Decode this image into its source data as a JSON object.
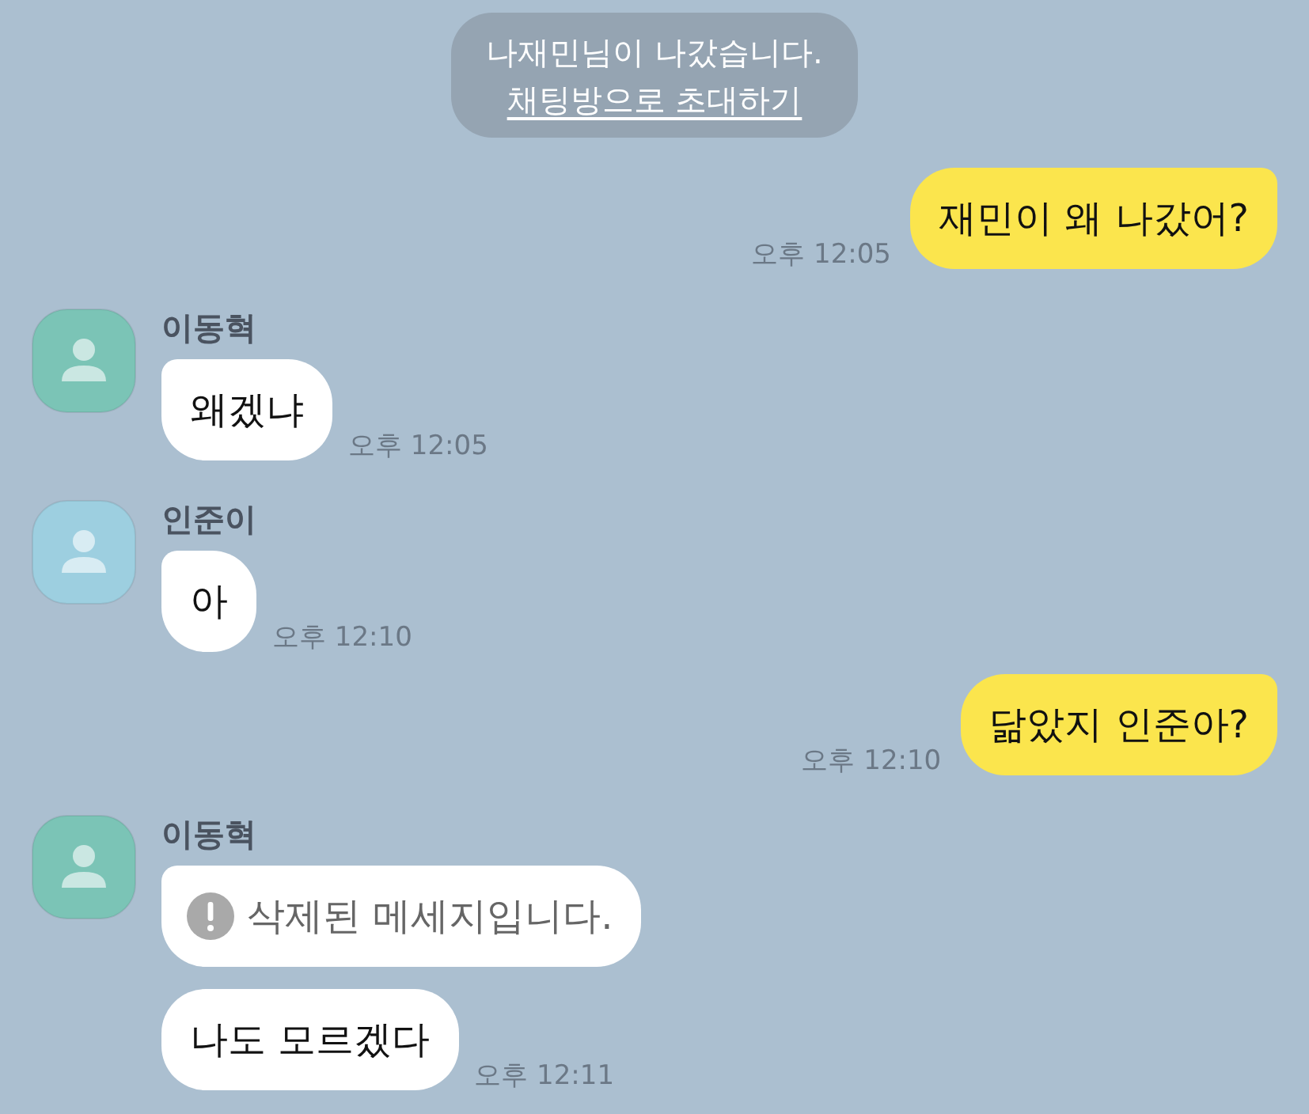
{
  "notice": {
    "text": "나재민님이 나갔습니다.",
    "link": "채팅방으로 초대하기"
  },
  "messages": [
    {
      "kind": "sent",
      "text": "재민이 왜 나갔어?",
      "time": "오후 12:05"
    },
    {
      "kind": "received",
      "sender": "이동혁",
      "color": "#7bc4b6",
      "bubbles": [
        {
          "kind": "text",
          "text": "왜겠냐"
        }
      ],
      "time": "오후 12:05"
    },
    {
      "kind": "received",
      "sender": "인준이",
      "color": "#9dcfe0",
      "bubbles": [
        {
          "kind": "text",
          "text": "아"
        }
      ],
      "time": "오후 12:10"
    },
    {
      "kind": "sent",
      "text": "닮았지 인준아?",
      "time": "오후 12:10"
    },
    {
      "kind": "received",
      "sender": "이동혁",
      "color": "#7bc4b6",
      "bubbles": [
        {
          "kind": "deleted",
          "text": "삭제된 메세지입니다."
        },
        {
          "kind": "text",
          "text": "나도 모르겠다"
        }
      ],
      "time": "오후 12:11"
    }
  ]
}
